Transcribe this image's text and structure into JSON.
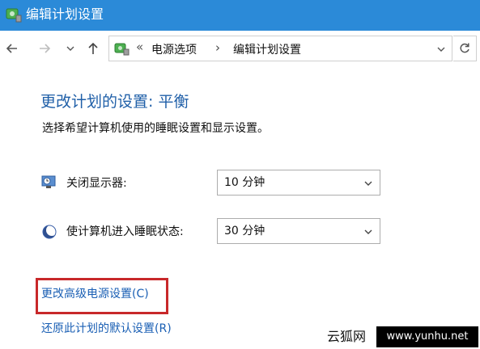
{
  "window": {
    "title": "编辑计划设置",
    "accent": "#2b8ad8"
  },
  "nav": {
    "back_icon": "arrow-left-icon",
    "forward_icon": "arrow-right-icon",
    "recent_icon": "chevron-down-icon",
    "up_icon": "arrow-up-icon"
  },
  "address": {
    "prefix": "«",
    "crumbs": [
      "电源选项",
      "编辑计划设置"
    ],
    "separator": "›"
  },
  "main": {
    "heading": "更改计划的设置: 平衡",
    "subtitle": "选择希望计算机使用的睡眠设置和显示设置。",
    "settings": [
      {
        "label": "关闭显示器:",
        "value": "10 分钟",
        "icon": "monitor-clock-icon"
      },
      {
        "label": "使计算机进入睡眠状态:",
        "value": "30 分钟",
        "icon": "moon-sleep-icon"
      }
    ],
    "advanced_link": "更改高级电源设置(C)",
    "restore_link": "还原此计划的默认设置(R)",
    "highlight_color": "#c8282a"
  },
  "watermark": {
    "left": "云狐网",
    "right": "www.yunhu.net"
  }
}
